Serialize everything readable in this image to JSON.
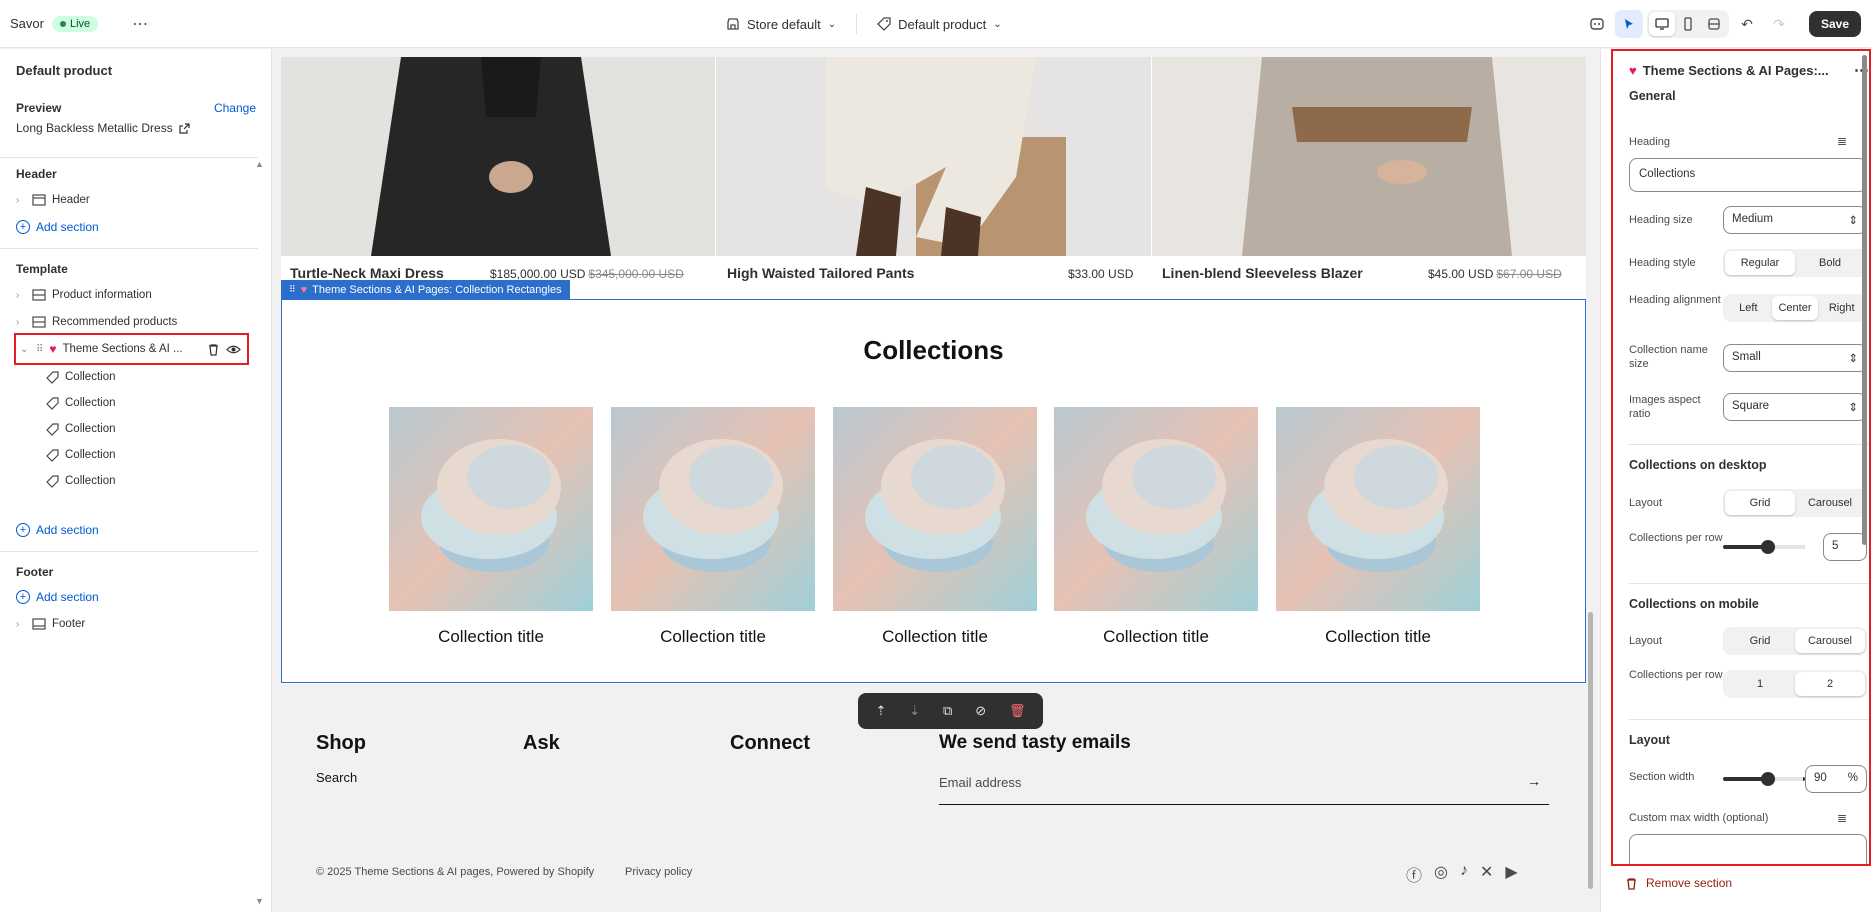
{
  "topbar": {
    "app_name": "Savor",
    "live_label": "Live",
    "store_dropdown": "Store default",
    "template_dropdown": "Default product",
    "save_label": "Save"
  },
  "sidebar": {
    "title": "Default product",
    "preview_label": "Preview",
    "change_label": "Change",
    "preview_product": "Long Backless Metallic Dress",
    "header_group": "Header",
    "header_item": "Header",
    "add_section": "Add section",
    "template_group": "Template",
    "template_items": [
      "Product information",
      "Recommended products"
    ],
    "selected_section": "Theme Sections & AI ...",
    "collection_blocks": [
      "Collection",
      "Collection",
      "Collection",
      "Collection",
      "Collection"
    ],
    "footer_group": "Footer",
    "footer_item": "Footer"
  },
  "canvas": {
    "products": [
      {
        "name": "Turtle-Neck Maxi Dress",
        "price": "$185,000.00 USD",
        "compare": "$345,000.00 USD"
      },
      {
        "name": "High Waisted Tailored Pants",
        "price": "$33.00 USD",
        "compare": ""
      },
      {
        "name": "Linen-blend Sleeveless Blazer",
        "price": "$45.00 USD",
        "compare": "$67.00 USD"
      }
    ],
    "section_tag": "Theme Sections & AI Pages: Collection Rectangles",
    "collections_heading": "Collections",
    "collection_titles": [
      "Collection title",
      "Collection title",
      "Collection title",
      "Collection title",
      "Collection title"
    ],
    "footer": {
      "headings": [
        "Shop",
        "Ask",
        "Connect",
        "We send tasty emails"
      ],
      "shop_link": "Search",
      "email_placeholder": "Email address",
      "copyright": "© 2025 Theme Sections & AI pages, Powered by Shopify",
      "privacy": "Privacy policy"
    }
  },
  "settings": {
    "title": "Theme Sections & AI Pages:...",
    "general": "General",
    "heading_label": "Heading",
    "heading_value": "Collections",
    "heading_size_label": "Heading size",
    "heading_size_value": "Medium",
    "heading_style_label": "Heading style",
    "heading_style_options": [
      "Regular",
      "Bold"
    ],
    "heading_alignment_label": "Heading alignment",
    "heading_alignment_options": [
      "Left",
      "Center",
      "Right"
    ],
    "collection_name_size_label": "Collection name size",
    "collection_name_size_value": "Small",
    "images_aspect_label": "Images aspect ratio",
    "images_aspect_value": "Square",
    "desktop_title": "Collections on desktop",
    "layout_label": "Layout",
    "layout_options": [
      "Grid",
      "Carousel"
    ],
    "per_row_label": "Collections per row",
    "desktop_per_row": "5",
    "mobile_title": "Collections on mobile",
    "mobile_per_row_options": [
      "1",
      "2"
    ],
    "layout_title": "Layout",
    "section_width_label": "Section width",
    "section_width_value": "90",
    "percent": "%",
    "custom_max_label": "Custom max width (optional)",
    "remove_label": "Remove section"
  },
  "colors": {
    "accent": "#2c6ecb",
    "highlight": "#e51c23",
    "save": "#303030"
  }
}
